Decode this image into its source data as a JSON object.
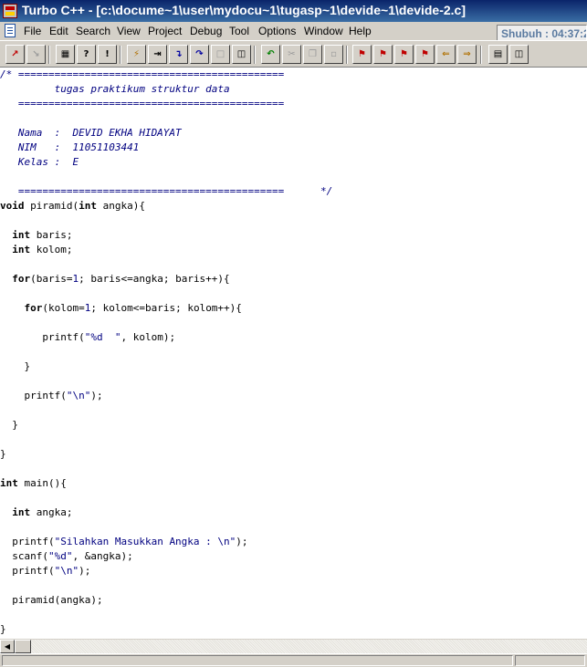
{
  "window": {
    "title": "Turbo C++ - [c:\\docume~1\\user\\mydocu~1\\tugasp~1\\devide~1\\devide-2.c]"
  },
  "menu": [
    "File",
    "Edit",
    "Search",
    "View",
    "Project",
    "Debug",
    "Tool",
    "Options",
    "Window",
    "Help"
  ],
  "clock": "Shubuh : 04:37:2",
  "toolbar": {
    "buttons": [
      "open-file",
      "save-file",
      "compile",
      "make",
      "build-all",
      "run",
      "step-over",
      "trace-into",
      "go-to-cursor",
      "evaluate",
      "watch",
      "undo",
      "cut",
      "copy",
      "paste",
      "toggle-breakpoint",
      "replace",
      "search",
      "search-again",
      "go-back",
      "go-forward",
      "tile-windows",
      "cascade-windows"
    ]
  },
  "editor": {
    "lines": [
      "/* ============================================",
      "         tugas praktikum struktur data",
      "   ============================================",
      "",
      "   Nama  :  DEVID EKHA HIDAYAT",
      "   NIM   :  11051103441",
      "   Kelas :  E",
      "",
      "   ============================================      */",
      "void piramid(int angka){",
      "",
      "  int baris;",
      "  int kolom;",
      "",
      "  for(baris=1; baris<=angka; baris++){",
      "",
      "    for(kolom=1; kolom<=baris; kolom++){",
      "",
      "       printf(\"%d  \", kolom);",
      "",
      "    }",
      "",
      "    printf(\"\\n\");",
      "",
      "  }",
      "",
      "}",
      "",
      "int main(){",
      "",
      "  int angka;",
      "",
      "  printf(\"Silahkan Masukkan Angka : \\n\");",
      "  scanf(\"%d\", &angka);",
      "  printf(\"\\n\");",
      "",
      "  piramid(angka);",
      "",
      "}"
    ]
  },
  "colors": {
    "comment": "#000080",
    "string": "#000080",
    "titlebar": "#0a246a"
  }
}
